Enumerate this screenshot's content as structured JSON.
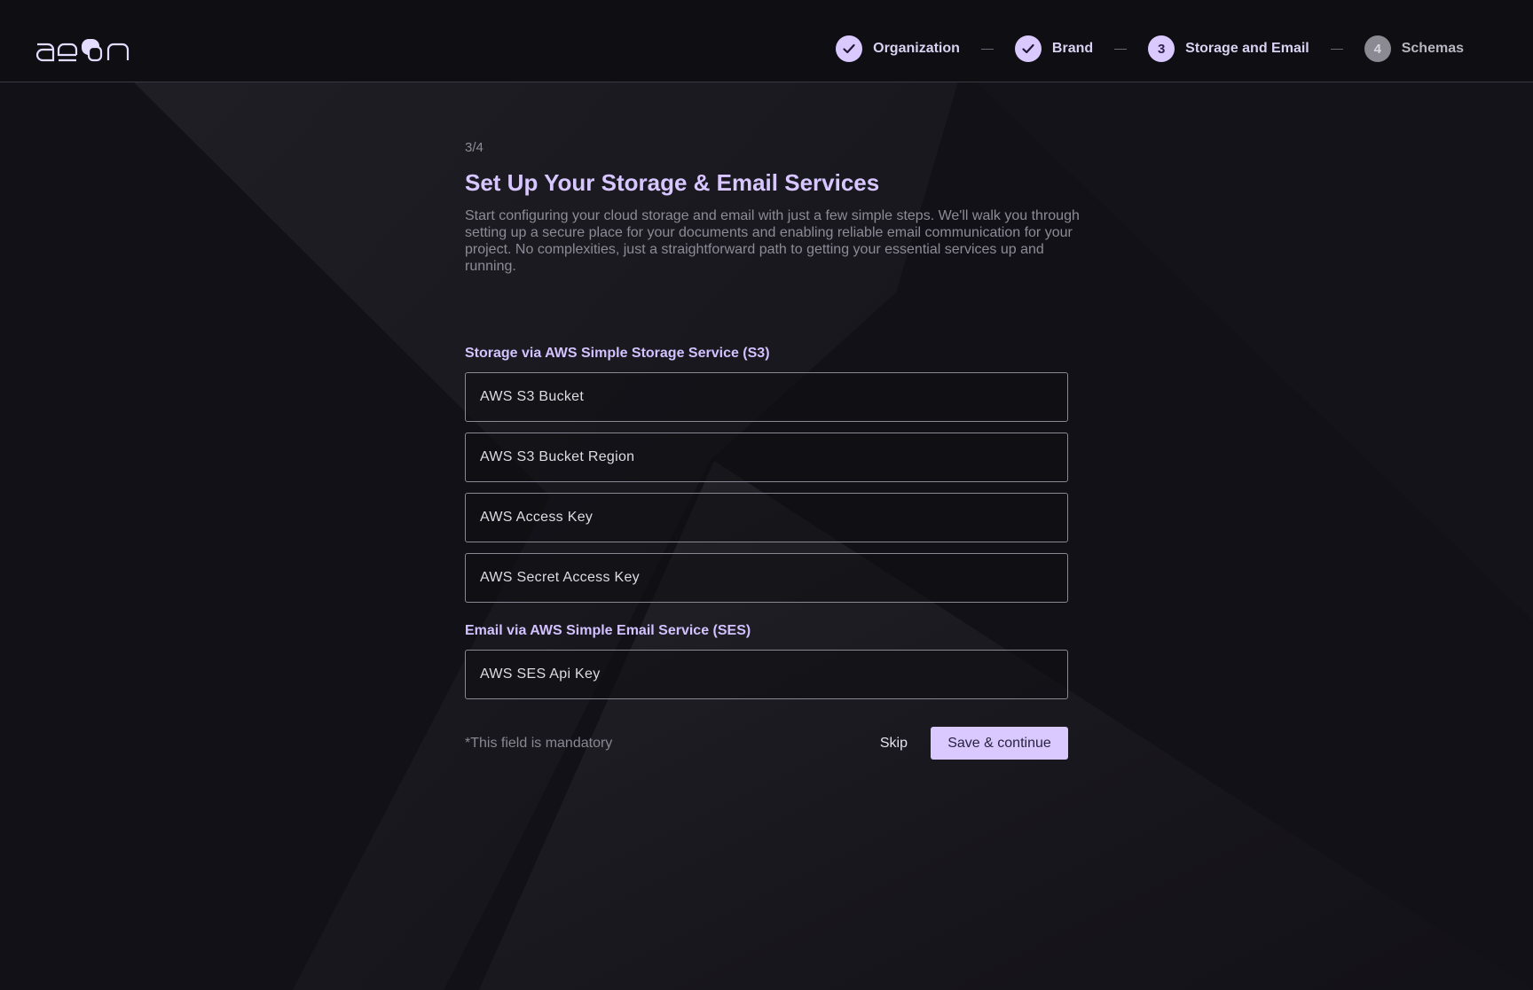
{
  "header": {
    "logo_text": "aeon",
    "steps": [
      {
        "number": "1",
        "label": "Organization",
        "status": "done",
        "icon": "check-icon"
      },
      {
        "number": "2",
        "label": "Brand",
        "status": "done",
        "icon": "check-icon"
      },
      {
        "number": "3",
        "label": "Storage and Email",
        "status": "active"
      },
      {
        "number": "4",
        "label": "Schemas",
        "status": "pending"
      }
    ]
  },
  "main": {
    "step_counter": "3/4",
    "title": "Set Up Your Storage & Email Services",
    "description": "Start configuring your cloud storage and email with just a few simple steps. We'll walk you through setting up a secure place for your documents and enabling reliable email communication for your project. No complexities, just a straightforward path to getting your essential services up and running.",
    "storage_section": {
      "label": "Storage via AWS Simple Storage Service (S3)",
      "fields": [
        {
          "placeholder": "AWS S3 Bucket",
          "value": ""
        },
        {
          "placeholder": "AWS S3 Bucket Region",
          "value": ""
        },
        {
          "placeholder": "AWS Access Key",
          "value": ""
        },
        {
          "placeholder": "AWS Secret Access Key",
          "value": ""
        }
      ]
    },
    "email_section": {
      "label": "Email via AWS Simple Email Service (SES)",
      "fields": [
        {
          "placeholder": "AWS SES Api Key",
          "value": ""
        }
      ]
    },
    "footer": {
      "mandatory_note": "*This field is mandatory",
      "skip_label": "Skip",
      "save_label": "Save & continue"
    }
  },
  "colors": {
    "background": "#121117",
    "accent": "#d9c9ff",
    "title": "#d7c6ff",
    "muted_text": "#8d8b96"
  }
}
